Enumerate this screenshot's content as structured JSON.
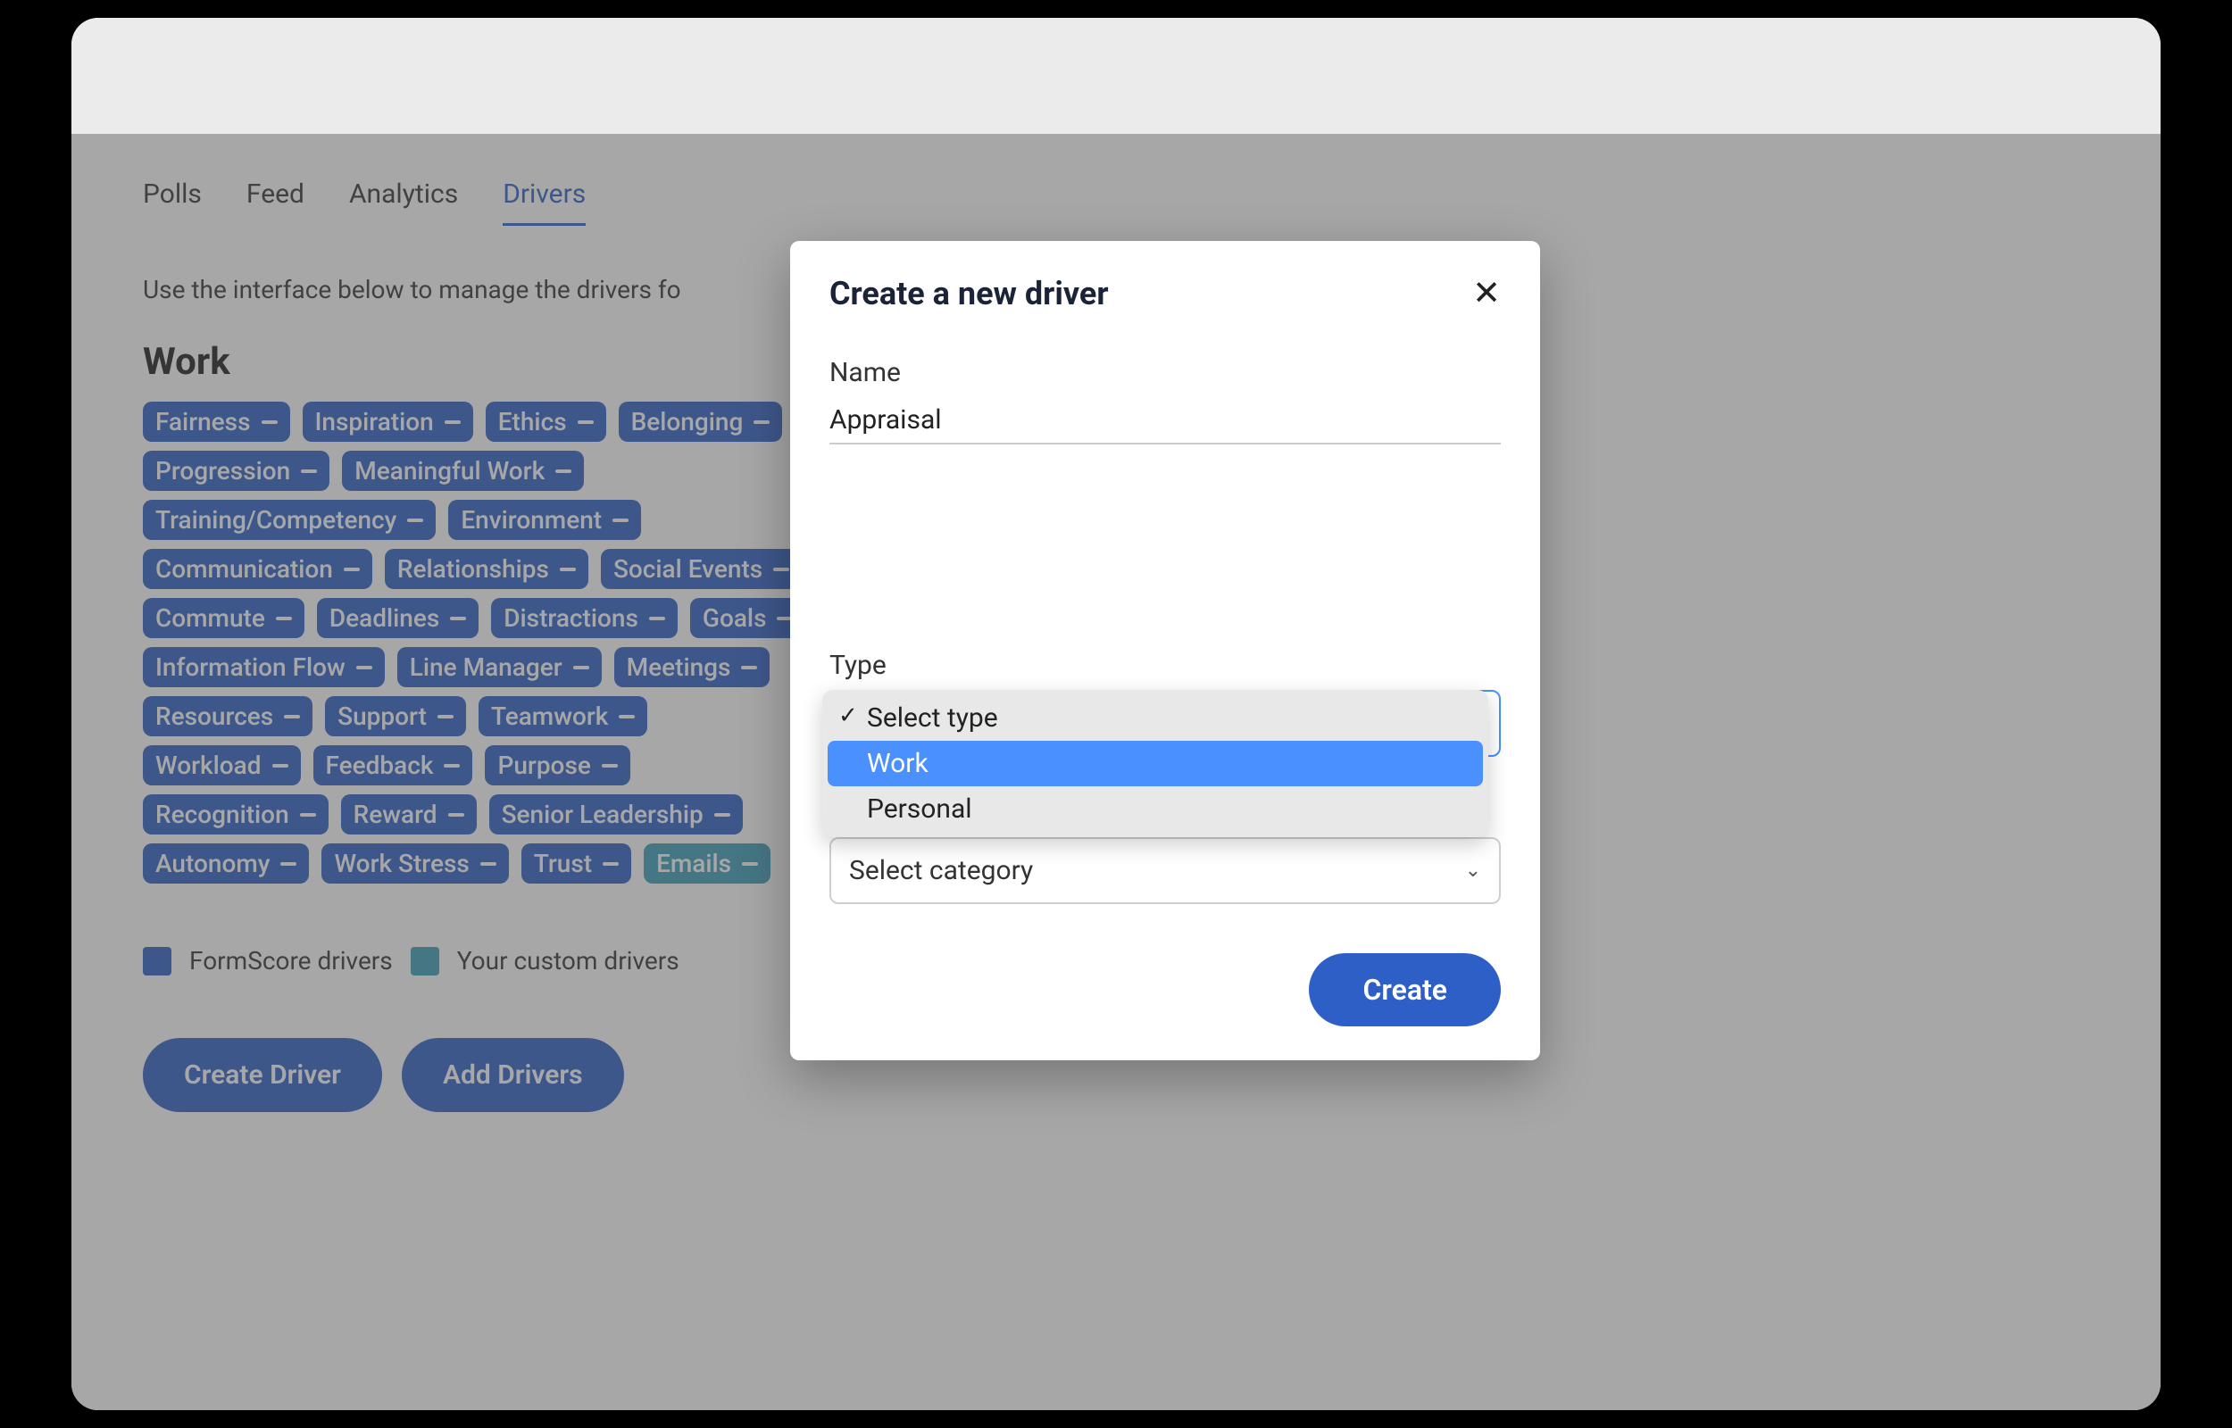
{
  "tabs": [
    {
      "label": "Polls",
      "active": false
    },
    {
      "label": "Feed",
      "active": false
    },
    {
      "label": "Analytics",
      "active": false
    },
    {
      "label": "Drivers",
      "active": true
    }
  ],
  "intro_text": "Use the interface below to manage the drivers fo",
  "section_title": "Work",
  "chips": [
    {
      "label": "Fairness",
      "custom": false
    },
    {
      "label": "Inspiration",
      "custom": false
    },
    {
      "label": "Ethics",
      "custom": false
    },
    {
      "label": "Belonging",
      "custom": false
    },
    {
      "label": "Progression",
      "custom": false
    },
    {
      "label": "Meaningful Work",
      "custom": false
    },
    {
      "label": "Training/Competency",
      "custom": false
    },
    {
      "label": "Environment",
      "custom": false
    },
    {
      "label": "Communication",
      "custom": false
    },
    {
      "label": "Relationships",
      "custom": false
    },
    {
      "label": "Social Events",
      "custom": false
    },
    {
      "label": "Commute",
      "custom": false
    },
    {
      "label": "Deadlines",
      "custom": false
    },
    {
      "label": "Distractions",
      "custom": false
    },
    {
      "label": "Goals",
      "custom": false
    },
    {
      "label": "Information Flow",
      "custom": false
    },
    {
      "label": "Line Manager",
      "custom": false
    },
    {
      "label": "Meetings",
      "custom": false
    },
    {
      "label": "Resources",
      "custom": false
    },
    {
      "label": "Support",
      "custom": false
    },
    {
      "label": "Teamwork",
      "custom": false
    },
    {
      "label": "Workload",
      "custom": false
    },
    {
      "label": "Feedback",
      "custom": false
    },
    {
      "label": "Purpose",
      "custom": false
    },
    {
      "label": "Recognition",
      "custom": false
    },
    {
      "label": "Reward",
      "custom": false
    },
    {
      "label": "Senior Leadership",
      "custom": false
    },
    {
      "label": "Autonomy",
      "custom": false
    },
    {
      "label": "Work Stress",
      "custom": false
    },
    {
      "label": "Trust",
      "custom": false
    },
    {
      "label": "Emails",
      "custom": true
    }
  ],
  "legend": {
    "formscore": "FormScore drivers",
    "custom": "Your custom drivers"
  },
  "buttons": {
    "create_driver": "Create Driver",
    "add_drivers": "Add Drivers"
  },
  "modal": {
    "title": "Create a new driver",
    "name_label": "Name",
    "name_value": "Appraisal",
    "type_label": "Type",
    "type_placeholder": "Select type",
    "type_options": [
      {
        "label": "Select type",
        "placeholder": true,
        "highlighted": false
      },
      {
        "label": "Work",
        "placeholder": false,
        "highlighted": true
      },
      {
        "label": "Personal",
        "placeholder": false,
        "highlighted": false
      }
    ],
    "category_placeholder": "Select category",
    "create_button": "Create"
  }
}
